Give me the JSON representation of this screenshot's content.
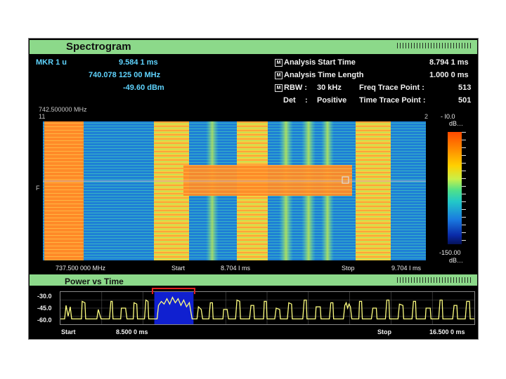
{
  "spectrogram": {
    "title": "Spectrogram",
    "marker": {
      "label": "MKR 1 u",
      "time": "9.584 1  ms",
      "freq": "740.078 125 00  MHz",
      "power": "-49.60  dBm"
    },
    "settings": {
      "start_label": "Analysis Start Time",
      "start_value": "8.794 1  ms",
      "length_label": "Analysis Time Length",
      "length_value": "1.000 0  ms",
      "rbw_label": "RBW :",
      "rbw_value": "30 kHz",
      "freq_trace_label": "Freq Trace Point :",
      "freq_trace_value": "513",
      "det_label": "Det",
      "det_colon": ":",
      "det_value": "Positive",
      "time_trace_label": "Time Trace Point :",
      "time_trace_value": "501"
    },
    "top_freq": "742.500000 MHz",
    "left_top_mark": "11",
    "left_mid_mark": "F",
    "right_top_mark": "2",
    "bottom_freq": "737.500 000 MHz",
    "start_label": "Start",
    "start_value": "8.704 I ms",
    "stop_label": "Stop",
    "stop_value": "9.704 I ms",
    "scale_top": "- I0.0",
    "scale_top_unit": "dB…",
    "scale_bottom": "-150.00",
    "scale_bottom_unit": "dB…"
  },
  "pvt": {
    "title": "Power vs Time",
    "y_ticks": [
      "-30.0",
      "-45.0",
      "-60.0"
    ],
    "start_label": "Start",
    "start_value": "8.500 0  ms",
    "stop_label": "Stop",
    "stop_value": "16.500 0  ms"
  },
  "colors": {
    "title_bar": "#8cd98a",
    "marker_text": "#5fd4ff",
    "trace": "#ffff80",
    "window_box": "#1020d0",
    "window_bracket": "#e02020"
  }
}
